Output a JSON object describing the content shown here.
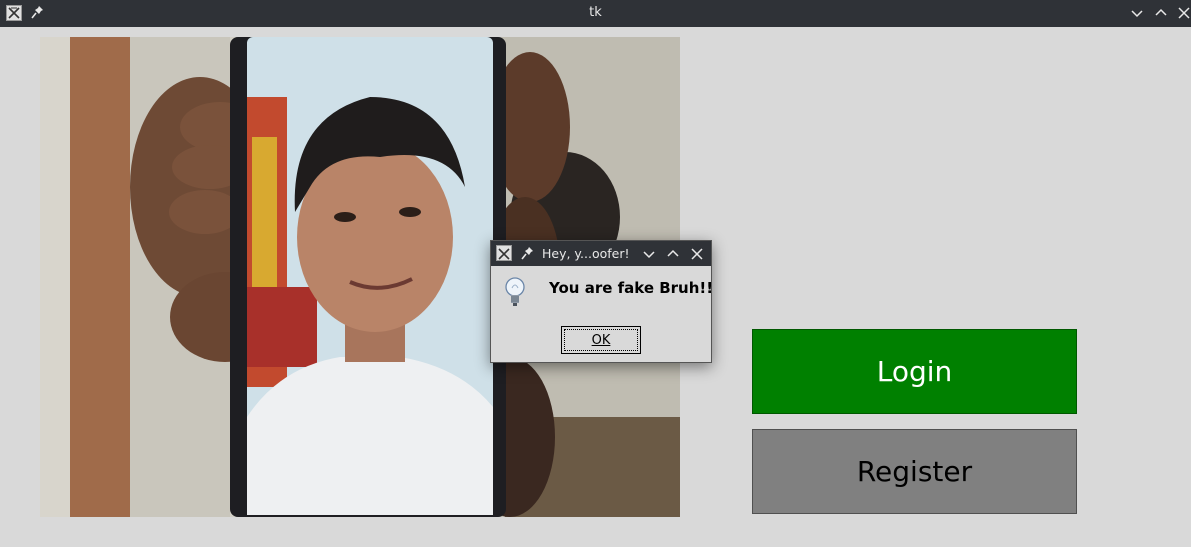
{
  "window": {
    "title": "tk"
  },
  "camera": {
    "description_icon": "camera-feed-image"
  },
  "buttons": {
    "login_label": "Login",
    "register_label": "Register",
    "login_color": "#008000",
    "register_color": "#808080"
  },
  "dialog": {
    "title": "Hey, y...oofer!",
    "message": "You are fake Bruh!!",
    "ok_label": "OK",
    "icon": "lightbulb-icon"
  }
}
